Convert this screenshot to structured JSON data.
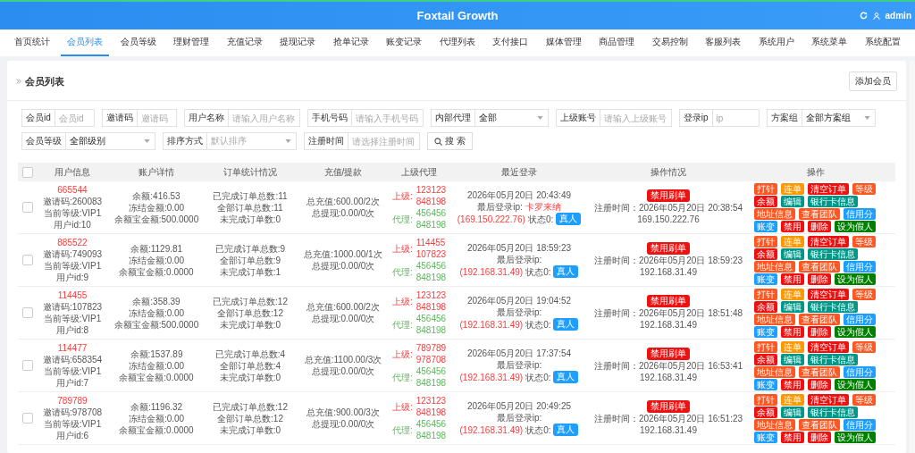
{
  "header": {
    "title": "Foxtail Growth",
    "user": "admin"
  },
  "nav": [
    {
      "label": "首页统计",
      "selected": false
    },
    {
      "label": "会员列表",
      "selected": true
    },
    {
      "label": "会员等级",
      "selected": false
    },
    {
      "label": "理财管理",
      "selected": false
    },
    {
      "label": "充值记录",
      "selected": false
    },
    {
      "label": "提现记录",
      "selected": false
    },
    {
      "label": "抢单记录",
      "selected": false
    },
    {
      "label": "账变记录",
      "selected": false
    },
    {
      "label": "代理列表",
      "selected": false
    },
    {
      "label": "支付接口",
      "selected": false
    },
    {
      "label": "媒体管理",
      "selected": false
    },
    {
      "label": "商品管理",
      "selected": false
    },
    {
      "label": "交易控制",
      "selected": false
    },
    {
      "label": "客服列表",
      "selected": false
    },
    {
      "label": "系统用户",
      "selected": false
    },
    {
      "label": "系统菜单",
      "selected": false
    },
    {
      "label": "系统配置",
      "selected": false
    }
  ],
  "page": {
    "title": "会员列表",
    "add_button": "添加会员"
  },
  "filters": [
    [
      {
        "label": "会员id",
        "kind": "input",
        "placeholder": "会员id"
      },
      {
        "label": "邀请码",
        "kind": "input",
        "placeholder": "邀请码"
      },
      {
        "label": "用户名称",
        "kind": "input",
        "placeholder": "请输入用户名称"
      },
      {
        "label": "手机号码",
        "kind": "input",
        "placeholder": "请输入手机号码"
      },
      {
        "label": "内部代理",
        "kind": "select",
        "value": "全部"
      },
      {
        "label": "上级账号",
        "kind": "input",
        "placeholder": "请输入上级账号"
      },
      {
        "label": "登录ip",
        "kind": "input",
        "placeholder": "ip"
      },
      {
        "label": "方案组",
        "kind": "select",
        "value": "全部方案组"
      }
    ],
    [
      {
        "label": "会员等级",
        "kind": "select",
        "value": "全部级别"
      },
      {
        "label": "排序方式",
        "kind": "select",
        "placeholder": "默认排序"
      },
      {
        "label": "注册时间",
        "kind": "input",
        "placeholder": "请选择注册时间"
      }
    ]
  ],
  "search_button": "搜 索",
  "table": {
    "select_all_checked": false,
    "columns": [
      "用户信息",
      "账户详情",
      "订单统计情况",
      "充值/提款",
      "上级代理",
      "最近登录",
      "操作情况",
      "操作"
    ],
    "rows": [
      {
        "checked": false,
        "user_id": "665544",
        "user_lines": [
          "邀请码:260083",
          "当前等级:VIP1",
          "用户id:10"
        ],
        "account": [
          "余额:416.53",
          "冻结金额:0.00",
          "余额宝金额:500.0000"
        ],
        "orders": [
          "已完成订单总数:11",
          "全部订单总数:11",
          "未完成订单数:0"
        ],
        "funds": [
          "总充值:600.00/2次",
          "总提现:0.00/0次"
        ],
        "superior_label": "上级:",
        "superior": [
          "123123",
          "848198"
        ],
        "agent_label": "代理:",
        "agent": [
          "456456",
          "848198"
        ],
        "login_time": "2026年05月20日 20:43:49",
        "login_ip_label": "最后登录ip:",
        "login_location": "卡罗来纳",
        "login_ip": "(169.150.222.76)",
        "state": "状态0:",
        "state_badge": "真人",
        "status_badge": "禁用刷单",
        "reg_time": "注册时间：2026年05月20日 20:38:54",
        "reg_ip": "169.150.222.76",
        "actions": [
          {
            "label": "打针",
            "color": "#ff5722"
          },
          {
            "label": "连单",
            "color": "#ff9800"
          },
          {
            "label": "清空订单",
            "color": "#ee1111"
          },
          {
            "label": "等级",
            "color": "#ff5722"
          },
          {
            "label": "余额",
            "color": "#ee1111"
          },
          {
            "label": "编辑",
            "color": "#009688"
          },
          {
            "label": "银行卡信息",
            "color": "#009688"
          },
          {
            "label": "地址信息",
            "color": "#ff5722"
          },
          {
            "label": "查看团队",
            "color": "#ff5722"
          },
          {
            "label": "信用分",
            "color": "#1e9fff"
          },
          {
            "label": "账变",
            "color": "#1e9fff"
          },
          {
            "label": "禁用",
            "color": "#ee1111"
          },
          {
            "label": "删除",
            "color": "#ee1111"
          },
          {
            "label": "设为假人",
            "color": "#008000"
          }
        ]
      },
      {
        "checked": false,
        "user_id": "885522",
        "user_lines": [
          "邀请码:749093",
          "当前等级:VIP1",
          "用户id:9"
        ],
        "account": [
          "余额:1129.81",
          "冻结金额:0.00",
          "余额宝金额:0.0000"
        ],
        "orders": [
          "已完成订单总数:9",
          "全部订单总数:9",
          "未完成订单数:1"
        ],
        "funds": [
          "总充值:1000.00/1次",
          "总提现:0.00/0次"
        ],
        "superior_label": "上级:",
        "superior": [
          "114455",
          "107823"
        ],
        "agent_label": "代理:",
        "agent": [
          "456456",
          "848198"
        ],
        "login_time": "2026年05月20日 18:59:23",
        "login_ip_label": "最后登录ip:",
        "login_ip": "(192.168.31.49)",
        "state": "状态0:",
        "state_badge": "真人",
        "status_badge": "禁用刷单",
        "reg_time": "注册时间：2026年05月20日 18:59:23",
        "reg_ip": "192.168.31.49",
        "actions": [
          {
            "label": "打针",
            "color": "#ff5722"
          },
          {
            "label": "连单",
            "color": "#ff9800"
          },
          {
            "label": "清空订单",
            "color": "#ee1111"
          },
          {
            "label": "等级",
            "color": "#ff5722"
          },
          {
            "label": "余额",
            "color": "#ee1111"
          },
          {
            "label": "编辑",
            "color": "#009688"
          },
          {
            "label": "银行卡信息",
            "color": "#009688"
          },
          {
            "label": "地址信息",
            "color": "#ff5722"
          },
          {
            "label": "查看团队",
            "color": "#ff5722"
          },
          {
            "label": "信用分",
            "color": "#1e9fff"
          },
          {
            "label": "账变",
            "color": "#1e9fff"
          },
          {
            "label": "禁用",
            "color": "#ee1111"
          },
          {
            "label": "删除",
            "color": "#ee1111"
          },
          {
            "label": "设为假人",
            "color": "#008000"
          }
        ]
      },
      {
        "checked": false,
        "user_id": "114455",
        "user_lines": [
          "邀请码:107823",
          "当前等级:VIP1",
          "用户id:8"
        ],
        "account": [
          "余额:358.39",
          "冻结金额:0.00",
          "余额宝金额:500.0000"
        ],
        "orders": [
          "已完成订单总数:12",
          "全部订单总数:12",
          "未完成订单数:0"
        ],
        "funds": [
          "总充值:600.00/2次",
          "总提现:0.00/0次"
        ],
        "superior_label": "上级:",
        "superior": [
          "123123",
          "848198"
        ],
        "agent_label": "代理:",
        "agent": [
          "456456",
          "848198"
        ],
        "login_time": "2026年05月20日 19:04:52",
        "login_ip_label": "最后登录ip:",
        "login_ip": "(192.168.31.49)",
        "state": "状态0:",
        "state_badge": "真人",
        "status_badge": "禁用刷单",
        "reg_time": "注册时间：2026年05月20日 18:51:48",
        "reg_ip": "192.168.31.49",
        "actions": [
          {
            "label": "打针",
            "color": "#ff5722"
          },
          {
            "label": "连单",
            "color": "#ff9800"
          },
          {
            "label": "清空订单",
            "color": "#ee1111"
          },
          {
            "label": "等级",
            "color": "#ff5722"
          },
          {
            "label": "余额",
            "color": "#ee1111"
          },
          {
            "label": "编辑",
            "color": "#009688"
          },
          {
            "label": "银行卡信息",
            "color": "#009688"
          },
          {
            "label": "地址信息",
            "color": "#ff5722"
          },
          {
            "label": "查看团队",
            "color": "#ff5722"
          },
          {
            "label": "信用分",
            "color": "#1e9fff"
          },
          {
            "label": "账变",
            "color": "#1e9fff"
          },
          {
            "label": "禁用",
            "color": "#ee1111"
          },
          {
            "label": "删除",
            "color": "#ee1111"
          },
          {
            "label": "设为假人",
            "color": "#008000"
          }
        ]
      },
      {
        "checked": false,
        "user_id": "114477",
        "user_lines": [
          "邀请码:658354",
          "当前等级:VIP1",
          "用户id:7"
        ],
        "account": [
          "余额:1537.89",
          "冻结金额:0.00",
          "余额宝金额:0.0000"
        ],
        "orders": [
          "已完成订单总数:4",
          "全部订单总数:4",
          "未完成订单数:0"
        ],
        "funds": [
          "总充值:1100.00/3次",
          "总提现:0.00/0次"
        ],
        "superior_label": "上级:",
        "superior": [
          "789789",
          "978708"
        ],
        "agent_label": "代理:",
        "agent": [
          "456456",
          "848198"
        ],
        "login_time": "2026年05月20日 17:37:54",
        "login_ip_label": "最后登录ip:",
        "login_ip": "(192.168.31.49)",
        "state": "状态0:",
        "state_badge": "真人",
        "status_badge": "禁用刷单",
        "reg_time": "注册时间：2026年05月20日 16:53:41",
        "reg_ip": "192.168.31.49",
        "actions": [
          {
            "label": "打针",
            "color": "#ff5722"
          },
          {
            "label": "连单",
            "color": "#ff9800"
          },
          {
            "label": "清空订单",
            "color": "#ee1111"
          },
          {
            "label": "等级",
            "color": "#ff5722"
          },
          {
            "label": "余额",
            "color": "#ee1111"
          },
          {
            "label": "编辑",
            "color": "#009688"
          },
          {
            "label": "银行卡信息",
            "color": "#009688"
          },
          {
            "label": "地址信息",
            "color": "#ff5722"
          },
          {
            "label": "查看团队",
            "color": "#ff5722"
          },
          {
            "label": "信用分",
            "color": "#1e9fff"
          },
          {
            "label": "账变",
            "color": "#1e9fff"
          },
          {
            "label": "禁用",
            "color": "#ee1111"
          },
          {
            "label": "删除",
            "color": "#ee1111"
          },
          {
            "label": "设为假人",
            "color": "#008000"
          }
        ]
      },
      {
        "checked": false,
        "user_id": "789789",
        "user_lines": [
          "邀请码:978708",
          "当前等级:VIP1",
          "用户id:6"
        ],
        "account": [
          "余额:1196.32",
          "冻结金额:0.00",
          "余额宝金额:0.0000"
        ],
        "orders": [
          "已完成订单总数:12",
          "全部订单总数:12",
          "未完成订单数:0"
        ],
        "funds": [
          "总充值:900.00/3次",
          "总提现:0.00/0次"
        ],
        "superior_label": "上级:",
        "superior": [
          "123123",
          "848198"
        ],
        "agent_label": "代理:",
        "agent": [
          "456456",
          "848198"
        ],
        "login_time": "2026年05月20日 20:49:25",
        "login_ip_label": "最后登录ip:",
        "login_ip": "(192.168.31.49)",
        "state": "状态0:",
        "state_badge": "真人",
        "status_badge": "禁用刷单",
        "reg_time": "注册时间：2026年05月20日 16:51:23",
        "reg_ip": "192.168.31.49",
        "actions": [
          {
            "label": "打针",
            "color": "#ff5722"
          },
          {
            "label": "连单",
            "color": "#ff9800"
          },
          {
            "label": "清空订单",
            "color": "#ee1111"
          },
          {
            "label": "等级",
            "color": "#ff5722"
          },
          {
            "label": "余额",
            "color": "#ee1111"
          },
          {
            "label": "编辑",
            "color": "#009688"
          },
          {
            "label": "银行卡信息",
            "color": "#009688"
          },
          {
            "label": "地址信息",
            "color": "#ff5722"
          },
          {
            "label": "查看团队",
            "color": "#ff5722"
          },
          {
            "label": "信用分",
            "color": "#1e9fff"
          },
          {
            "label": "账变",
            "color": "#1e9fff"
          },
          {
            "label": "禁用",
            "color": "#ee1111"
          },
          {
            "label": "删除",
            "color": "#ee1111"
          },
          {
            "label": "设为假人",
            "color": "#008000"
          }
        ]
      }
    ]
  }
}
